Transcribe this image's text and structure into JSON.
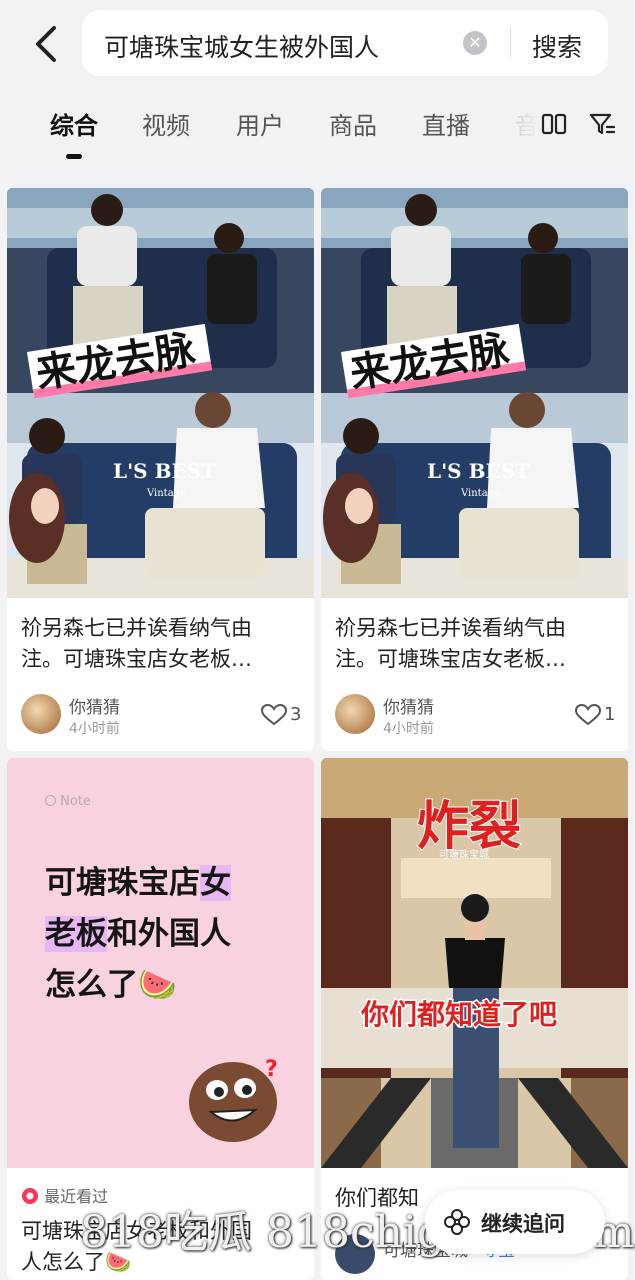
{
  "search": {
    "query": "可塘珠宝城女生被外国人",
    "button": "搜索"
  },
  "tabs": [
    "综合",
    "视频",
    "用户",
    "商品",
    "直播",
    "音"
  ],
  "cards": [
    {
      "overlay": "来龙去脉",
      "title_line1": "祄另森七已并诶看纳气由",
      "title_line2": "注。可塘珠宝店女老板…",
      "author": "你猜猜",
      "time": "4小时前",
      "likes": "3",
      "sign1": "L'S BEST",
      "sign2": "Vintage"
    },
    {
      "overlay": "来龙去脉",
      "title_line1": "祄另森七已并诶看纳气由",
      "title_line2": "注。可塘珠宝店女老板…",
      "author": "你猜猜",
      "time": "4小时前",
      "likes": "1",
      "sign1": "L'S BEST",
      "sign2": "Vintage"
    },
    {
      "note_label": "Note",
      "note_line1a": "可塘珠宝店",
      "note_line1b": "女",
      "note_line2a": "老板",
      "note_line2b": "和外国人",
      "note_line3": "怎么了",
      "recent": "最近看过",
      "title_line1": "可塘珠宝店女老板和外国",
      "title_line2": "人怎么了"
    },
    {
      "overlay_top": "炸裂",
      "mall_sign": "可塘珠宝城",
      "overlay_bottom": "你们都知道了吧",
      "title_line1": "你们都知",
      "author": "可塘珠宝城",
      "author_tag": "寻宝"
    }
  ],
  "floating": {
    "continue": "继续追问"
  },
  "watermark": "818吃瓜 818chigua5.com",
  "colors": {
    "accent": "#ff3355",
    "note_bg": "#f8d3df",
    "highlight": "#e6b7f3"
  }
}
